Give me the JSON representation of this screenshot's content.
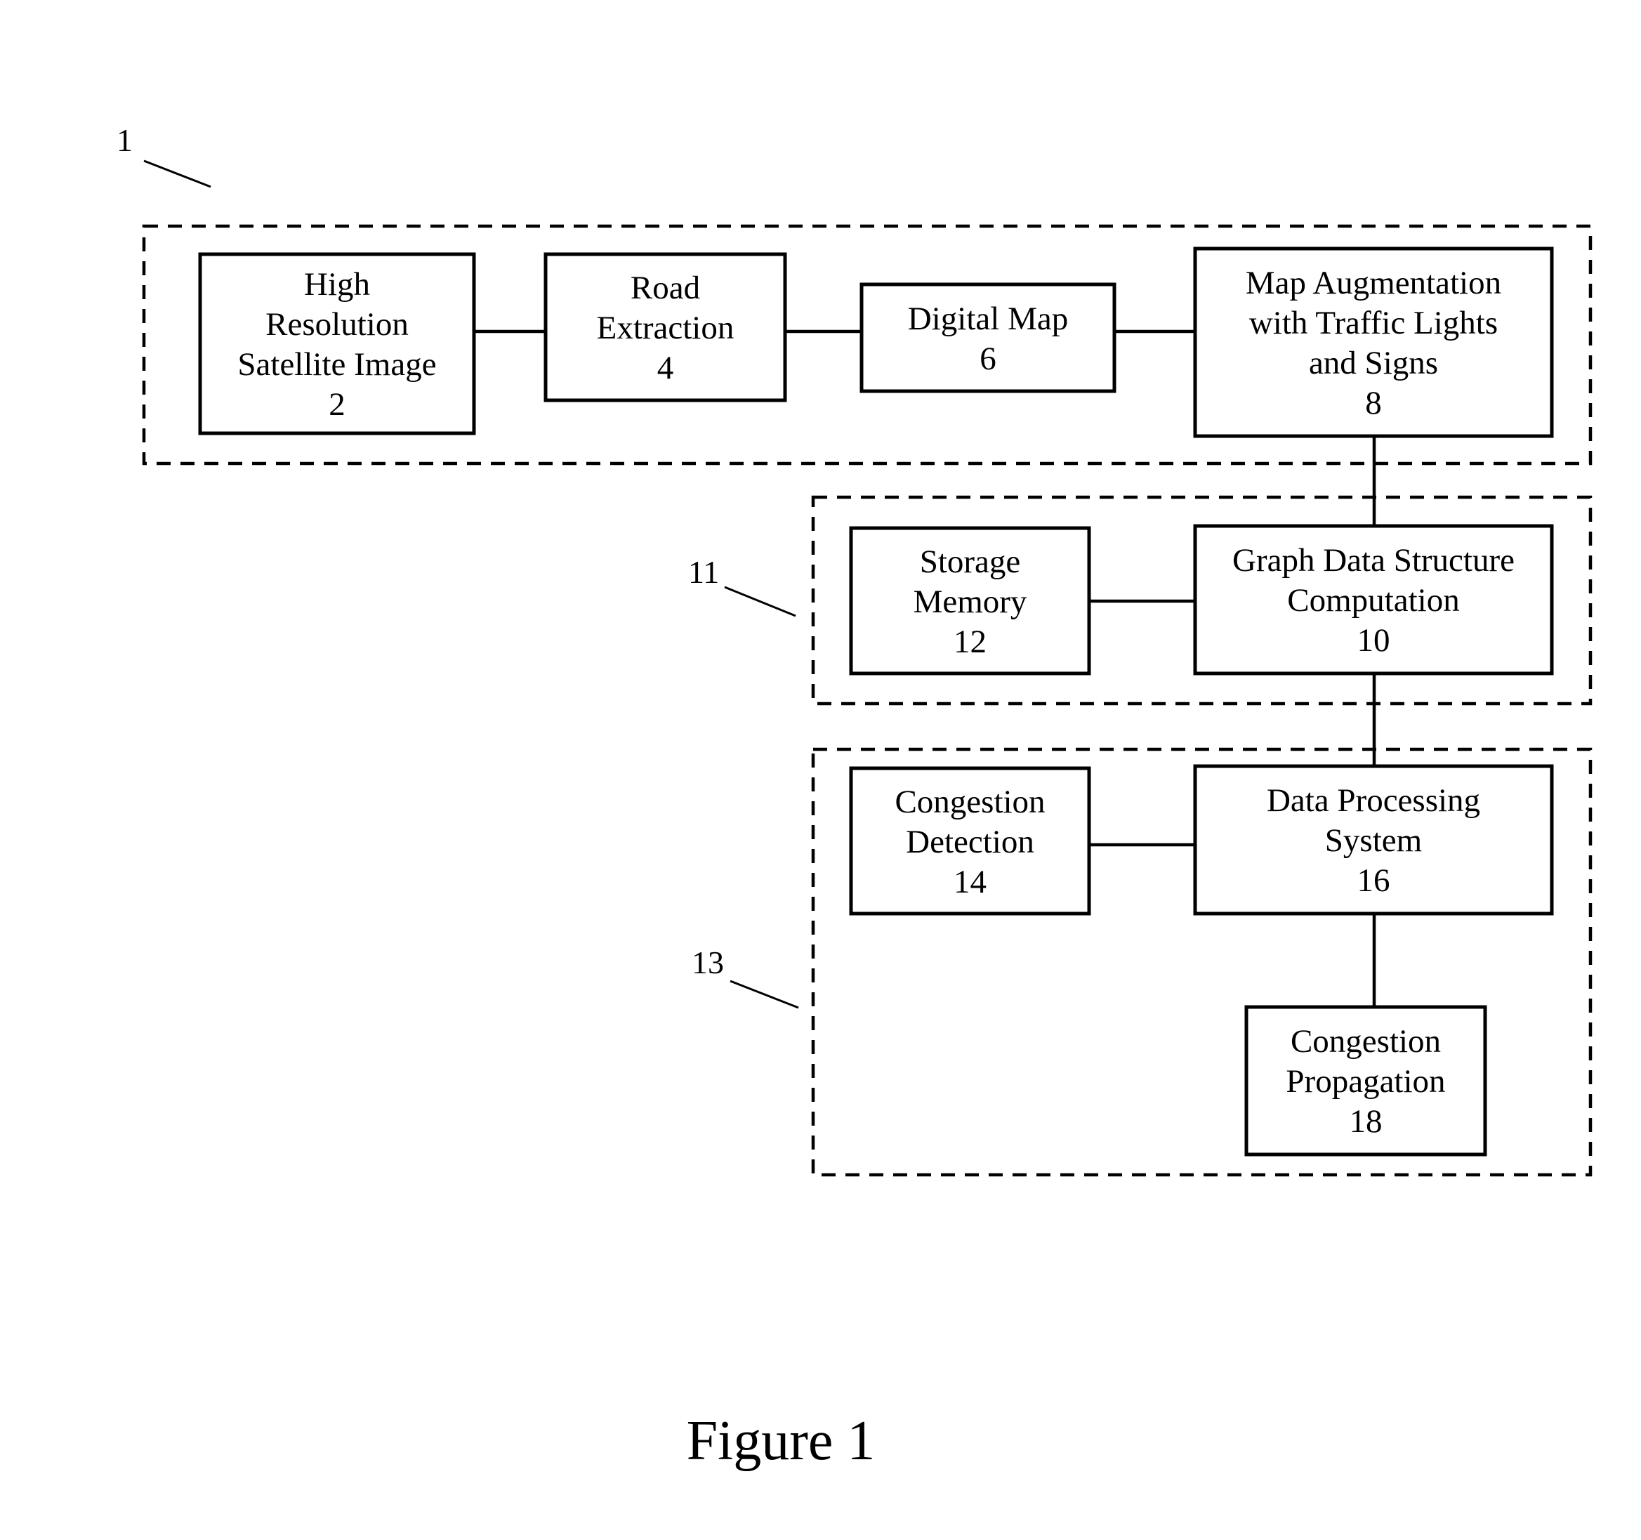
{
  "figure": {
    "caption": "Figure 1",
    "reference_labels": {
      "system": "1",
      "storage_group": "11",
      "processing_group": "13"
    },
    "blocks": {
      "satellite": {
        "lines": [
          "High",
          "Resolution",
          "Satellite Image",
          "2"
        ]
      },
      "road_extraction": {
        "lines": [
          "Road",
          "Extraction",
          "4"
        ]
      },
      "digital_map": {
        "lines": [
          "Digital Map",
          "6"
        ]
      },
      "map_augmentation": {
        "lines": [
          "Map Augmentation",
          "with Traffic Lights",
          "and Signs",
          "8"
        ]
      },
      "graph_computation": {
        "lines": [
          "Graph Data Structure",
          "Computation",
          "10"
        ]
      },
      "storage_memory": {
        "lines": [
          "Storage",
          "Memory",
          "12"
        ]
      },
      "congestion_detection": {
        "lines": [
          "Congestion",
          "Detection",
          "14"
        ]
      },
      "data_processing": {
        "lines": [
          "Data Processing",
          "System",
          "16"
        ]
      },
      "congestion_propagation": {
        "lines": [
          "Congestion",
          "Propagation",
          "18"
        ]
      }
    },
    "connections": [
      [
        "satellite",
        "road_extraction"
      ],
      [
        "road_extraction",
        "digital_map"
      ],
      [
        "digital_map",
        "map_augmentation"
      ],
      [
        "map_augmentation",
        "graph_computation"
      ],
      [
        "storage_memory",
        "graph_computation"
      ],
      [
        "graph_computation",
        "data_processing"
      ],
      [
        "congestion_detection",
        "data_processing"
      ],
      [
        "data_processing",
        "congestion_propagation"
      ]
    ]
  }
}
